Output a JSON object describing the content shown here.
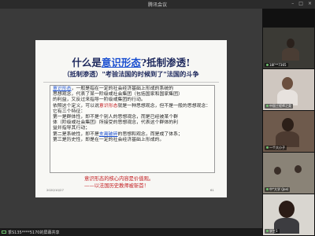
{
  "window": {
    "title": "腾讯会议"
  },
  "slide": {
    "title_prefix": "什么是",
    "title_highlight": "意识形态",
    "title_suffix": "?抵制渗透!",
    "subtitle": "（抵制渗透）\"考验法国的时候到了\"法国的斗争",
    "box": {
      "line1_link": "意识形态",
      "line1_rest": "，一般是指在一定的社会经济基础上形成的系统的",
      "line2": "思想观念，代表了某一阶级或社会集团（包括国家和国家集团）",
      "line3": "的利益，又反过来指导一阶级或集团的行动。",
      "line4_prefix": "依照这个定义，可以说",
      "line4_red": "意识形态",
      "line4_rest": "就是一种思想观念，但不是一般的思想观念：",
      "line5": "它有三个特征：",
      "line6": "第一是群体性，即不是个别人的思想观念，而是已经被某个群",
      "line7": "体（阶级或社会集团）所接受的思想观念，代表这个群体的利",
      "line8": "益并指导其行动；",
      "line9_prefix": "第二是系统性，即不是",
      "line9_link": "支离破碎",
      "line9_rest": "的思想和观念，而是成了体系；",
      "line10": "第三是历史性，即是在一定的社会经济基础上形成的。"
    },
    "red_line1": "意识形态的核心内容是价值观。",
    "red_line2": "——以法国历史教师被斩首！",
    "date": "2020/10/27",
    "page": "61"
  },
  "bottom_bar": {
    "share_label": "季S135****5170的屏幕共享"
  },
  "participants": [
    {
      "name": "18F**7365",
      "icon": "mic-icon"
    },
    {
      "name": "中国工程师之类",
      "icon": "mic-icon"
    },
    {
      "name": "一个大小子",
      "icon": "mic-icon"
    },
    {
      "name": "中*大学 (Joe)",
      "icon": "mic-icon"
    },
    {
      "name": "学生1",
      "icon": "mic-icon"
    }
  ]
}
